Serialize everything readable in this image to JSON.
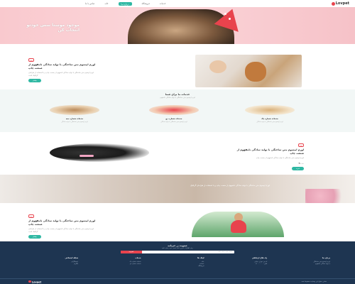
{
  "nav": {
    "brand": "Lovpet",
    "links": [
      "خدمات",
      "فروشگاه",
      "درباره ما",
      "خانه",
      "تماس با ما"
    ],
    "active_index": 2
  },
  "hero": {
    "title": "موجود موستا سس خودتو انتخاب کن"
  },
  "section_about": {
    "badge": "پت",
    "heading": "لورم ایپسوم متن ساختگی با تولید سادگی نامفهوم از صنعت چاپ",
    "body": "لورم ایپسوم متن ساختگی با تولید سادگی نامفهوم از صنعت چاپ و با استفاده از طراحان گرافیک است",
    "button": "بیشتر"
  },
  "services": {
    "title": "خدمات ما برای شما",
    "caption": "لورم ایپسوم متن ساختگی با تولید سادگی نامفهوم",
    "cards": [
      {
        "name": "خدمات شماره یک",
        "desc": "لورم ایپسوم متن ساختگی با تولید سادگی"
      },
      {
        "name": "خدمات شماره دو",
        "desc": "لورم ایپسوم متن ساختگی با تولید سادگی"
      },
      {
        "name": "خدمات شماره سه",
        "desc": "لورم ایپسوم متن ساختگی با تولید سادگی"
      }
    ]
  },
  "section_product": {
    "badge": "پت",
    "heading": "لورم ایپسوم متن ساختگی با تولید سادگی نامفهوم از صنعت چاپ",
    "body": "لورم ایپسوم متن ساختگی با تولید سادگی نامفهوم از صنعت چاپ",
    "price": "۲۰۰۰",
    "button": "خرید"
  },
  "banner": {
    "text": "لورم ایپسوم متن ساختگی با تولید سادگی نامفهوم از صنعت چاپ و با استفاده از طراحان گرافیک"
  },
  "section_love": {
    "badge": "پت",
    "heading": "لورم ایپسوم متن ساختگی با تولید سادگی نامفهوم از صنعت چاپ",
    "body": "لورم ایپسوم متن ساختگی با تولید سادگی نامفهوم از صنعت چاپ و با استفاده از طراحان گرافیک است",
    "button": "بیشتر"
  },
  "footer": {
    "newsletter_title": "عضویت در خبرنامه",
    "newsletter_caption": "برای اطلاع از آخرین اخبار ایمیل خود را وارد کنید",
    "newsletter_placeholder": "ایمیل خود را وارد کنید",
    "newsletter_button": "عضویت",
    "columns": [
      {
        "heading": "درباره ما",
        "items": [
          "لورم ایپسوم متن ساختگی",
          "با تولید سادگی نامفهوم"
        ]
      },
      {
        "heading": "راه های ارتباطی",
        "items": [
          "آدرس: تهران خیابان",
          "تلفن: ۰۲۱۰۰۰۰۰۰۰"
        ]
      },
      {
        "heading": "لینک ها",
        "items": [
          "خانه",
          "خدمات",
          "فروشگاه"
        ]
      },
      {
        "heading": "خدمات",
        "items": [
          "خدمات شماره یک",
          "خدمات شماره دو"
        ]
      },
      {
        "heading": "شبکه اجتماعی",
        "items": [
          "اینستاگرام",
          "تلگرام"
        ]
      }
    ],
    "copyright": "تمامی حقوق این وبسایت محفوظ است",
    "brand": "Lovpet"
  },
  "colors": {
    "accent": "#2fb8a3",
    "brand": "#e8434d",
    "footer_bg": "#1e3551",
    "hero_bg": "#f9c9ce"
  }
}
